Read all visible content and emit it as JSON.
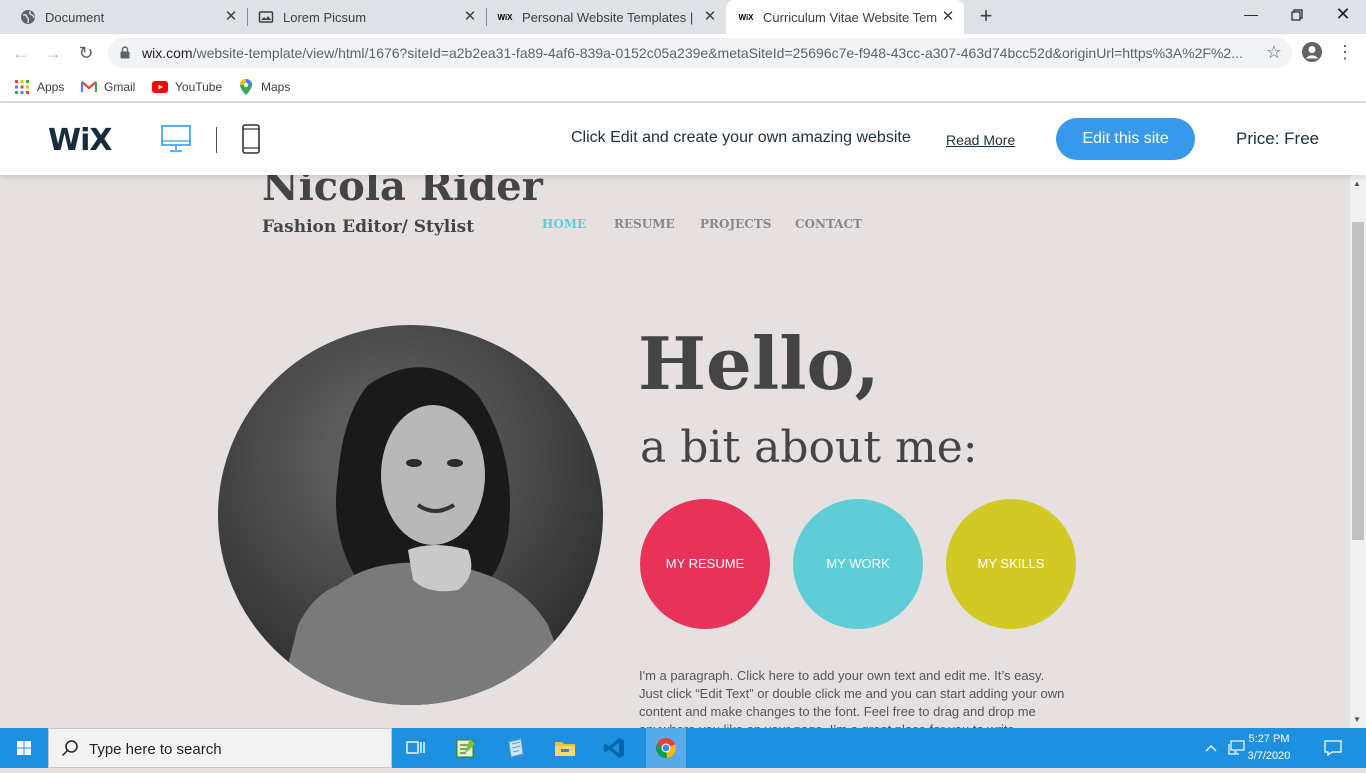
{
  "browser": {
    "tabs": [
      {
        "title": "Document",
        "icon": "globe-icon"
      },
      {
        "title": "Lorem Picsum",
        "icon": "image-icon"
      },
      {
        "title": "Personal Website Templates | Por",
        "icon": "wix-icon"
      },
      {
        "title": "Curriculum Vitae Website Templa",
        "icon": "wix-icon",
        "active": true
      }
    ],
    "url_main": "wix.com",
    "url_rest": "/website-template/view/html/1676?siteId=a2b2ea31-fa89-4af6-839a-0152c05a239e&metaSiteId=25696c7e-f948-43cc-a307-463d74bcc52d&originUrl=https%3A%2F%2...",
    "bookmarks": [
      {
        "label": "Apps",
        "icon": "apps-grid-icon"
      },
      {
        "label": "Gmail",
        "icon": "gmail-icon"
      },
      {
        "label": "YouTube",
        "icon": "youtube-icon"
      },
      {
        "label": "Maps",
        "icon": "maps-pin-icon"
      }
    ]
  },
  "wix": {
    "logo": "WiX",
    "message": "Click Edit and create your own amazing website",
    "read_more": "Read More",
    "edit_button": "Edit this site",
    "price": "Price: Free"
  },
  "site": {
    "name": "Nicola Rider",
    "role": "Fashion Editor/ Stylist",
    "nav": [
      "HOME",
      "RESUME",
      "PROJECTS",
      "CONTACT"
    ],
    "hello": "Hello,",
    "about": "a bit about me:",
    "circles": [
      {
        "label": "MY RESUME",
        "color": "#e8325a"
      },
      {
        "label": "MY WORK",
        "color": "#5fcdd6"
      },
      {
        "label": "MY SKILLS",
        "color": "#d2c924"
      }
    ],
    "paragraph": "I'm a paragraph. Click here to add your own text and edit me. It’s easy. Just click “Edit Text” or double click me and you can start adding your own content and make changes to the font. Feel free to drag and drop me anywhere you like on your page. I’m a great place for you to write"
  },
  "taskbar": {
    "search_placeholder": "Type here to search",
    "time": "5:27 PM",
    "date": "3/7/2020"
  }
}
